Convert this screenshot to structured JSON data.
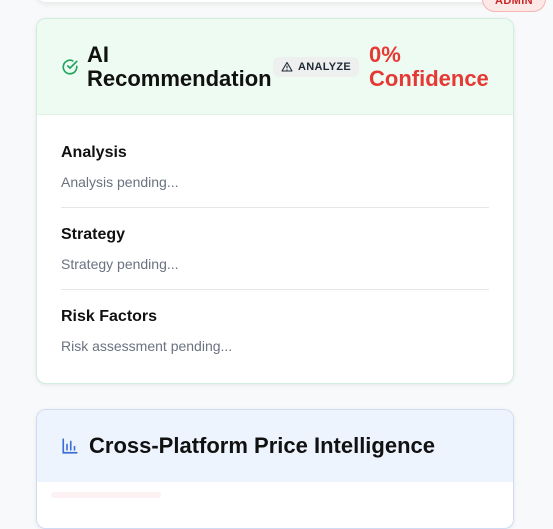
{
  "admin_badge": {
    "label": "ADMIN"
  },
  "recommendation": {
    "title": "AI Recommendation",
    "badge_label": "ANALYZE",
    "confidence_text": "0% Confidence",
    "sections": [
      {
        "title": "Analysis",
        "body": "Analysis pending..."
      },
      {
        "title": "Strategy",
        "body": "Strategy pending..."
      },
      {
        "title": "Risk Factors",
        "body": "Risk assessment pending..."
      }
    ]
  },
  "price_intelligence": {
    "title": "Cross-Platform Price Intelligence"
  },
  "colors": {
    "confidence": "#e53935",
    "success_icon": "#22a45d",
    "chart_icon": "#3b6fd8",
    "rec_header_bg": "#edfbf2",
    "price_header_bg": "#eef4fd"
  },
  "icons": {
    "recommendation": "check-circle-icon",
    "badge": "warning-triangle-icon",
    "price": "bar-chart-icon"
  }
}
